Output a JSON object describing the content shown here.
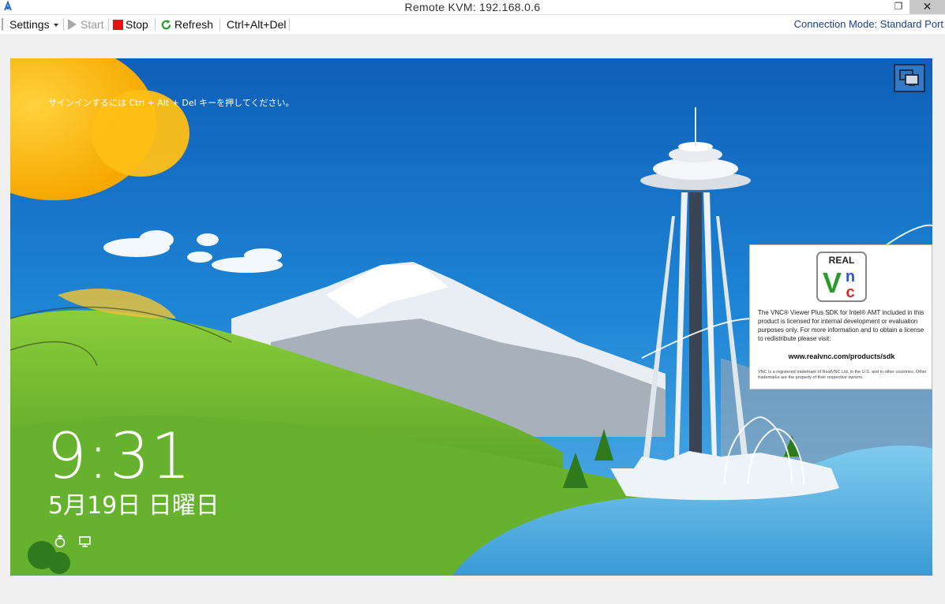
{
  "window": {
    "title": "Remote KVM: 192.168.0.6",
    "restore_glyph": "❐",
    "close_glyph": "✕"
  },
  "toolbar": {
    "settings_label": "Settings",
    "start_label": "Start",
    "stop_label": "Stop",
    "refresh_label": "Refresh",
    "cad_label": "Ctrl+Alt+Del",
    "connection_mode": "Connection Mode: Standard Port"
  },
  "remote_screen": {
    "signin_hint": "サインインするには Ctrl + Alt + Del キーを押してください。",
    "time": "9:31",
    "date": "5月19日 日曜日",
    "icons": [
      "ease-of-access-icon",
      "network-icon"
    ]
  },
  "vnc_notice": {
    "logo_text": "REAL VNC",
    "body": "The VNC® Viewer Plus SDK for Intel® AMT included in this product is licensed for internal development or evaluation purposes only.  For more information and to obtain a license to redistribute please visit:",
    "url": "www.realvnc.com/products/sdk",
    "legal": "VNC is a registered trademark of RealVNC Ltd. in the U.S. and in other countries. Other trademarks are the property of their respective owners."
  },
  "colors": {
    "stop": "#e31313",
    "refresh": "#2aa12f",
    "sky": "#1e7fd0",
    "grass": "#5fae2c",
    "connection_mode_text": "#1e3f8a"
  }
}
